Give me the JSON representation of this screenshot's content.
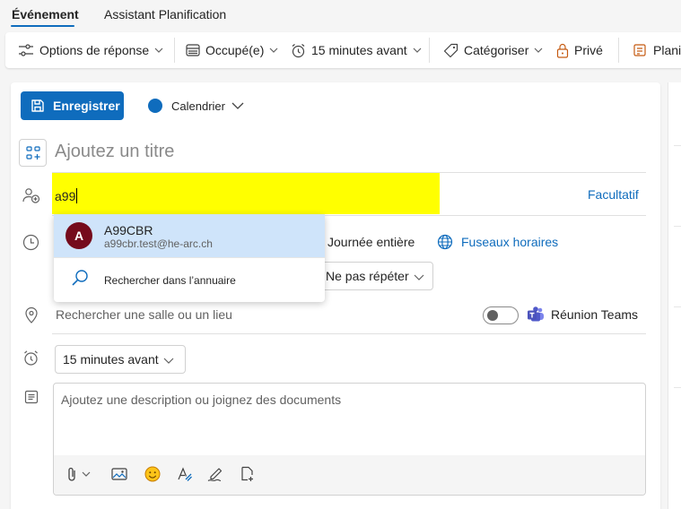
{
  "tabs": [
    "Événement",
    "Assistant Planification"
  ],
  "ribbon": {
    "response_options": "Options de réponse",
    "busy": "Occupé(e)",
    "reminder": "15 minutes avant",
    "categorize": "Catégoriser",
    "private": "Privé",
    "planner": "Planifi"
  },
  "save_button": "Enregistrer",
  "calendar_label": "Calendrier",
  "title_placeholder": "Ajoutez un titre",
  "attendees": {
    "typed": "a99",
    "optional_label": "Facultatif"
  },
  "suggestions": [
    {
      "initial": "A",
      "name": "A99CBR",
      "email": "a99cbr.test@he-arc.ch"
    }
  ],
  "directory_search": "Rechercher dans l’annuaire",
  "all_day_label": "Journée entière",
  "timezones_label": "Fuseaux horaires",
  "repeat_value": "Ne pas répéter",
  "location_placeholder": "Rechercher une salle ou un lieu",
  "teams_label": "Réunion Teams",
  "teams_enabled": false,
  "reminder_value": "15 minutes avant",
  "description_placeholder": "Ajoutez une description ou joignez des documents",
  "colors": {
    "accent": "#0f6cbd",
    "highlight": "#ffff00",
    "avatar": "#750b1c",
    "suggestion_selected": "#cfe4fa"
  }
}
